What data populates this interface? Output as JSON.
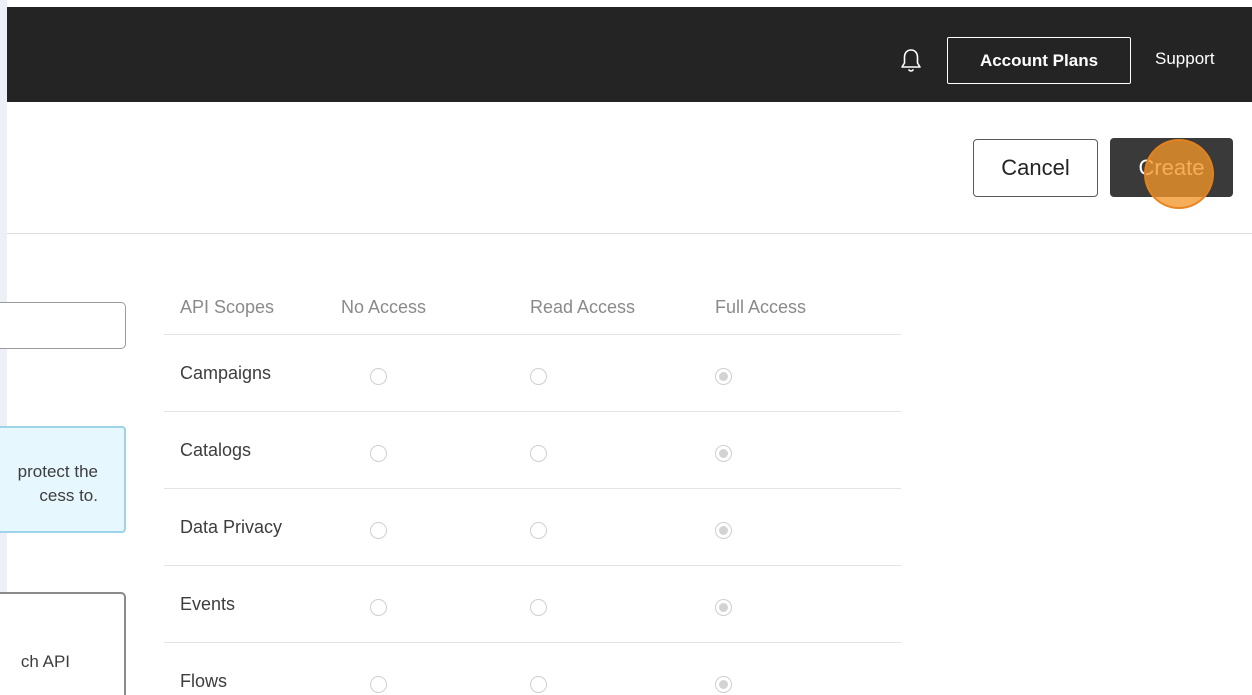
{
  "topbar": {
    "account_plans_label": "Account Plans",
    "support_label": "Support",
    "bell_icon": "bell-icon"
  },
  "actions": {
    "cancel_label": "Cancel",
    "create_label": "Create"
  },
  "info_box": {
    "line1": "protect the",
    "line2": "cess to."
  },
  "key_box": {
    "text": "ch API"
  },
  "scopes_table": {
    "headers": [
      "API Scopes",
      "No Access",
      "Read Access",
      "Full Access"
    ],
    "rows": [
      {
        "scope": "Campaigns",
        "selected": "Full Access"
      },
      {
        "scope": "Catalogs",
        "selected": "Full Access"
      },
      {
        "scope": "Data Privacy",
        "selected": "Full Access"
      },
      {
        "scope": "Events",
        "selected": "Full Access"
      },
      {
        "scope": "Flows",
        "selected": "Full Access"
      }
    ]
  },
  "colors": {
    "topbar_bg": "#242424",
    "primary_button": "#3a3a3a",
    "info_bg": "#e6f7fd",
    "info_border": "#9fd3ea",
    "click_marker": "#f49628"
  }
}
